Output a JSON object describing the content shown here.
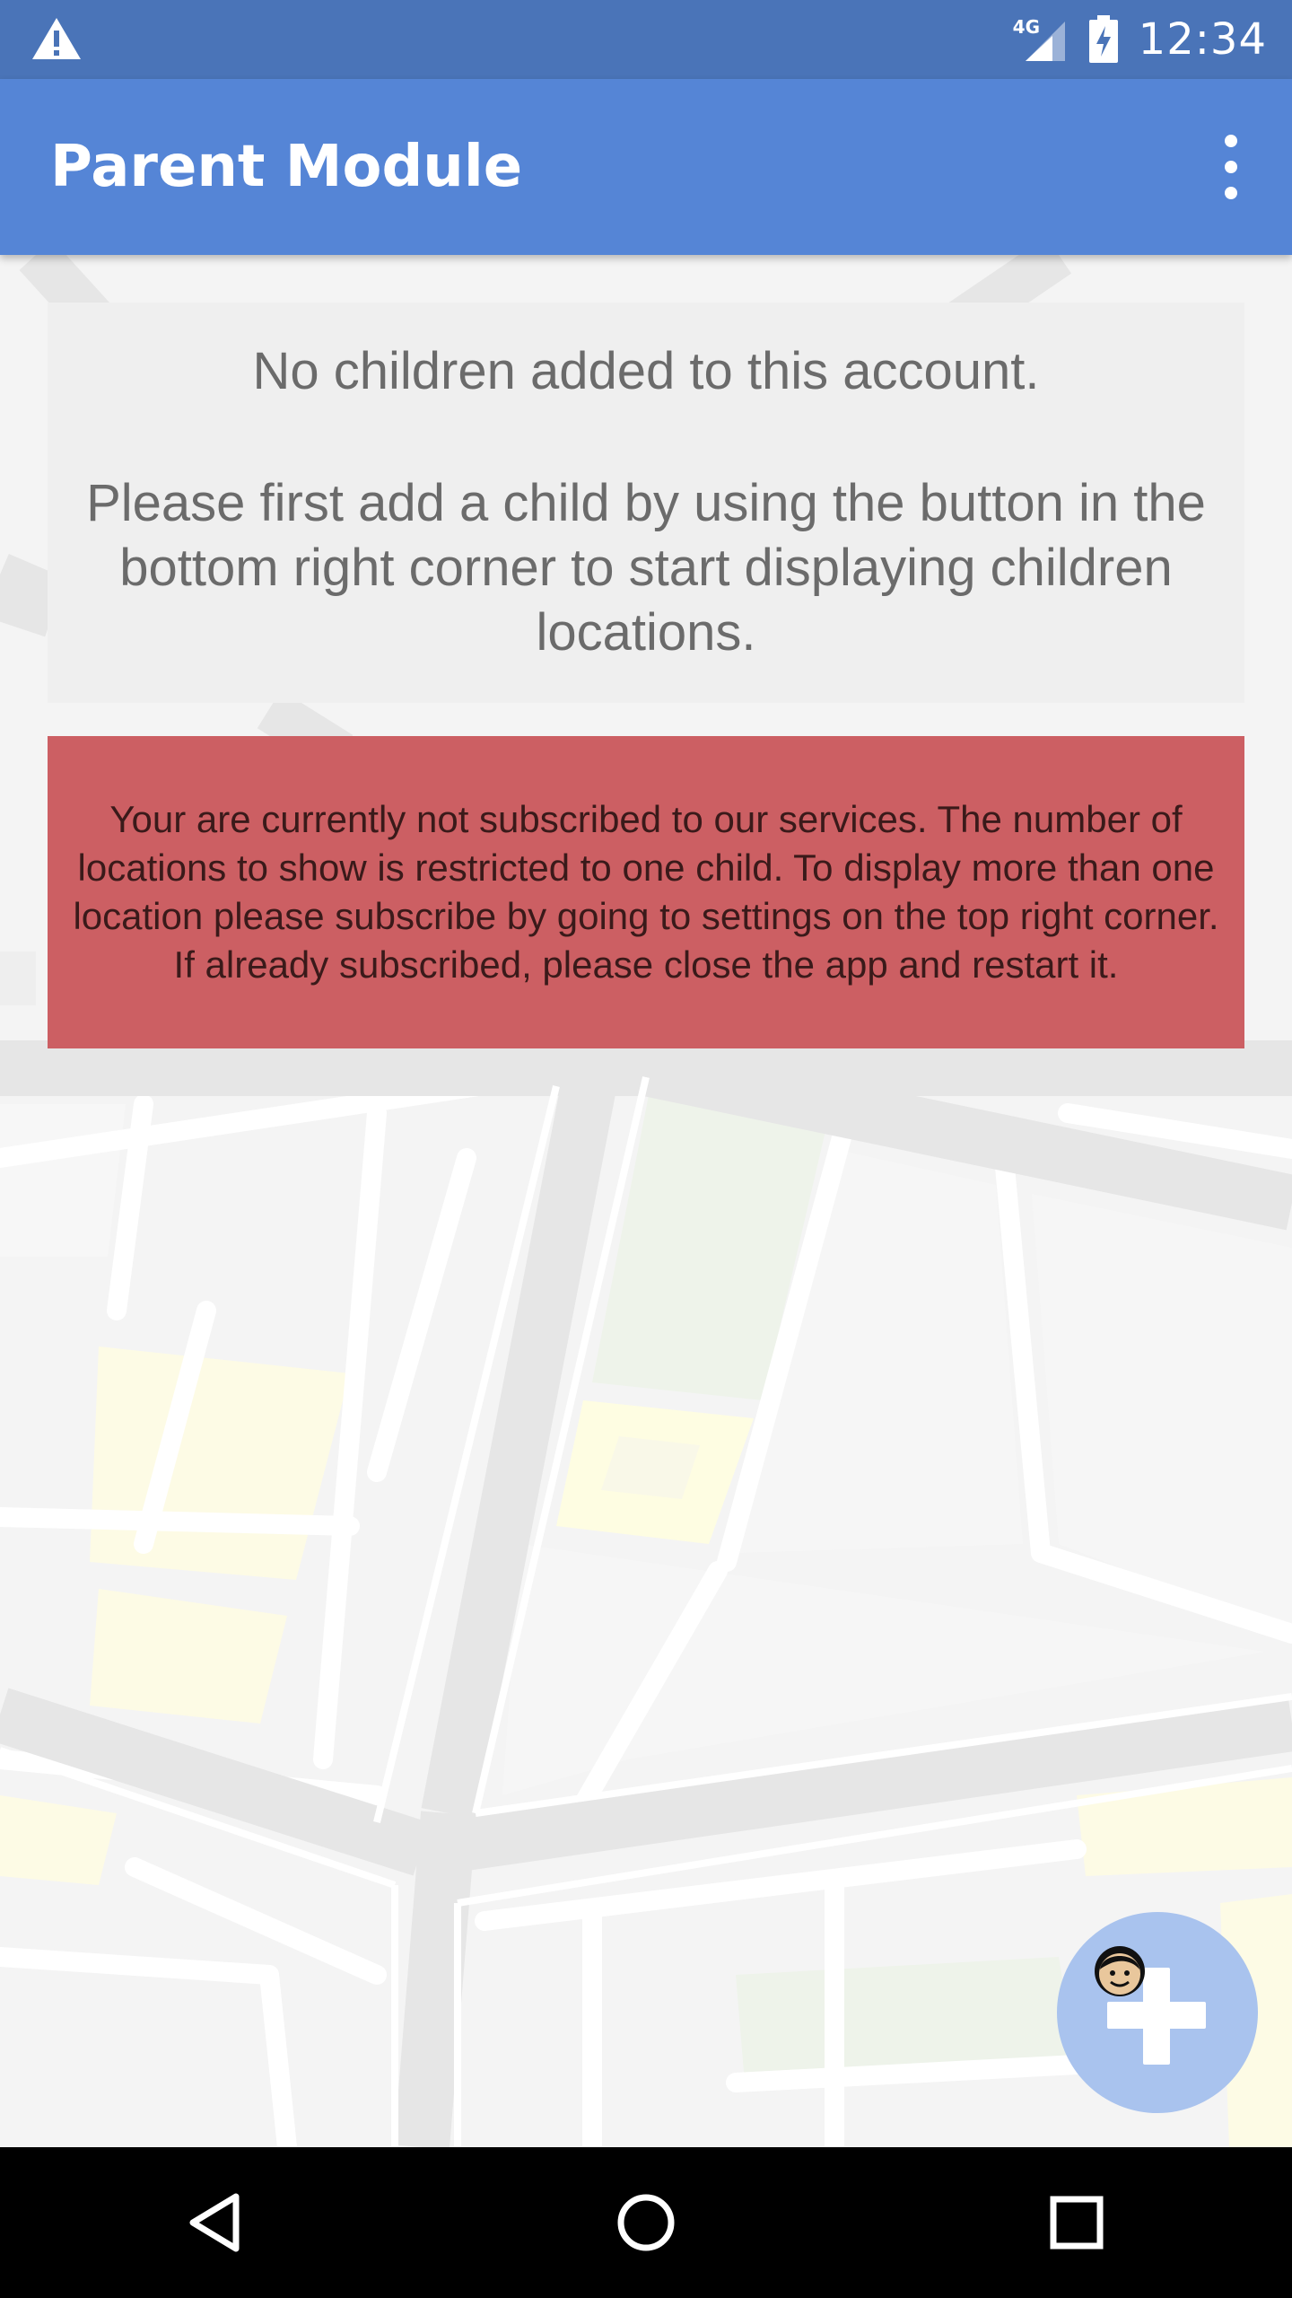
{
  "status_bar": {
    "network_label": "4G",
    "time": "12:34"
  },
  "app_bar": {
    "title": "Parent Module"
  },
  "info_card": {
    "line1": "No children added to this account.",
    "line2": "Please first add a child by using the button in the bottom right corner to start displaying children locations."
  },
  "warning_banner": {
    "text": "Your are currently not subscribed to our services. The number of locations to show is restricted to one child. To display more than one location please subscribe by going to settings on the top right corner. If already subscribed, please close the app and restart it."
  },
  "icons": {
    "status_warning": "warning-icon",
    "signal": "signal-icon",
    "battery": "battery-charging-icon",
    "overflow": "more-vert-icon",
    "fab": "add-child-icon",
    "nav_back": "back-icon",
    "nav_home": "home-icon",
    "nav_recents": "recents-icon"
  },
  "colors": {
    "status_bar": "#4a74b8",
    "app_bar": "#5585d6",
    "warning_banner": "#cc5f63",
    "fab": "#a9c3ee"
  }
}
